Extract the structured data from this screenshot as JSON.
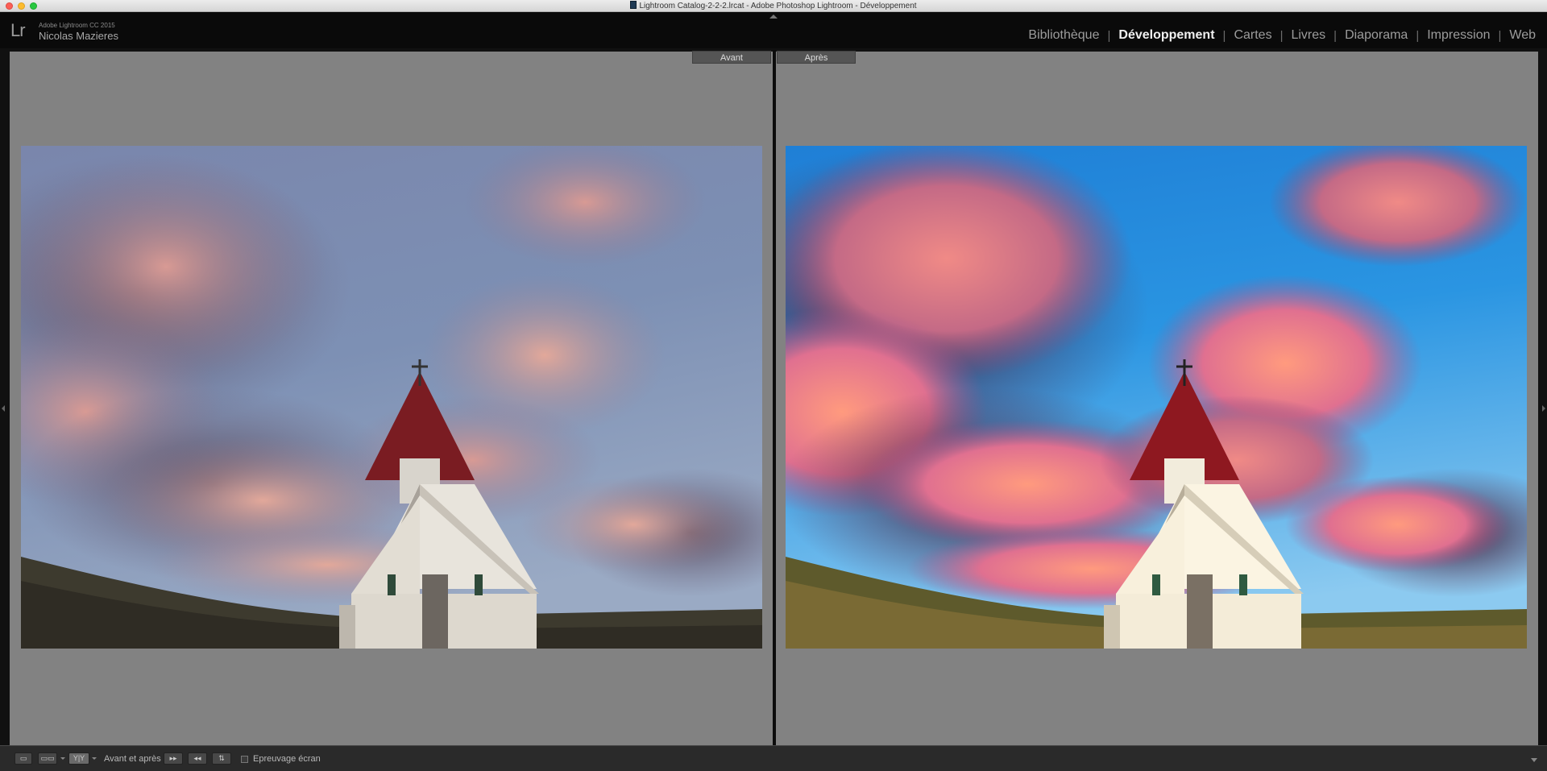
{
  "window": {
    "title": "Lightroom  Catalog-2-2-2.lrcat - Adobe Photoshop Lightroom - Développement"
  },
  "identity": {
    "logo": "Lr",
    "product": "Adobe Lightroom CC 2015",
    "user": "Nicolas Mazieres"
  },
  "modules": [
    {
      "label": "Bibliothèque",
      "active": false
    },
    {
      "label": "Développement",
      "active": true
    },
    {
      "label": "Cartes",
      "active": false
    },
    {
      "label": "Livres",
      "active": false
    },
    {
      "label": "Diaporama",
      "active": false
    },
    {
      "label": "Impression",
      "active": false
    },
    {
      "label": "Web",
      "active": false
    }
  ],
  "panes": {
    "before_label": "Avant",
    "after_label": "Après"
  },
  "toolbar": {
    "view_mode_label": "Y|Y",
    "before_after_label": "Avant et après :",
    "soft_proof_label": "Epreuvage écran"
  },
  "icons": {
    "loupe": "loupe-view-icon",
    "compare": "compare-view-icon",
    "before_after": "before-after-view-icon",
    "copy_before_to_after": "copy-settings-icon",
    "copy_after_to_before": "copy-settings-icon",
    "swap": "swap-icon"
  }
}
